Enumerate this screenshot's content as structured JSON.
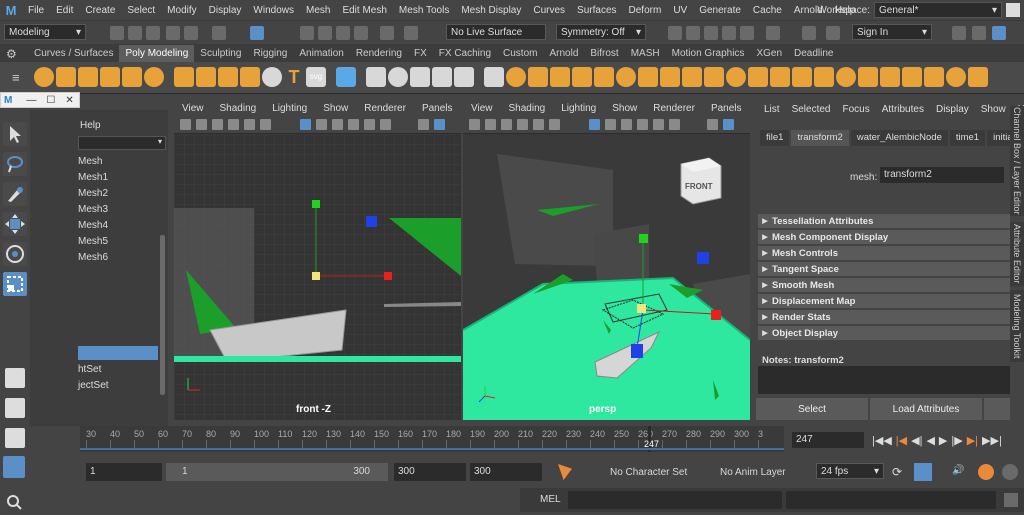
{
  "menubar": {
    "items": [
      "File",
      "Edit",
      "Create",
      "Select",
      "Modify",
      "Display",
      "Windows",
      "Mesh",
      "Edit Mesh",
      "Mesh Tools",
      "Mesh Display",
      "Curves",
      "Surfaces",
      "Deform",
      "UV",
      "Generate",
      "Cache",
      "Arnold",
      "Help"
    ],
    "workspace_label": "Workspace:",
    "workspace_value": "General*"
  },
  "statusline": {
    "mode": "Modeling",
    "live_surface": "No Live Surface",
    "symmetry": "Symmetry: Off",
    "sign_in": "Sign In"
  },
  "shelf_tabs": [
    "Curves / Surfaces",
    "Poly Modeling",
    "Sculpting",
    "Rigging",
    "Animation",
    "Rendering",
    "FX",
    "FX Caching",
    "Custom",
    "Arnold",
    "Bifrost",
    "MASH",
    "Motion Graphics",
    "XGen",
    "Deadline"
  ],
  "shelf_active_tab": "Poly Modeling",
  "outliner": {
    "help": "Help",
    "items": [
      "Mesh",
      "Mesh1",
      "Mesh2",
      "Mesh3",
      "Mesh4",
      "Mesh5",
      "Mesh6"
    ],
    "sets": [
      "htSet",
      "jectSet"
    ]
  },
  "viewport_left": {
    "menu": [
      "View",
      "Shading",
      "Lighting",
      "Show",
      "Renderer",
      "Panels"
    ],
    "label": "front -Z"
  },
  "viewport_right": {
    "menu": [
      "View",
      "Shading",
      "Lighting",
      "Show",
      "Renderer",
      "Panels"
    ],
    "label": "persp",
    "cube_label": "FRONT"
  },
  "channel_box": {
    "menu": [
      "List",
      "Selected",
      "Focus",
      "Attributes",
      "Display",
      "Show",
      "Help"
    ],
    "tabs": [
      "file1",
      "transform2",
      "water_AlembicNode",
      "time1",
      "initialS"
    ],
    "active_tab": "transform2",
    "mesh_label": "mesh:",
    "mesh_value": "transform2",
    "sections": [
      "Tessellation Attributes",
      "Mesh Component Display",
      "Mesh Controls",
      "Tangent Space",
      "Smooth Mesh",
      "Displacement Map",
      "Render Stats",
      "Object Display"
    ],
    "notes_label": "Notes:  transform2",
    "select_btn": "Select",
    "load_btn": "Load Attributes",
    "side_tabs": [
      "Channel Box / Layer Editor",
      "Attribute Editor",
      "Modeling Toolkit"
    ]
  },
  "timeline": {
    "ticks": [
      "30",
      "40",
      "50",
      "60",
      "70",
      "80",
      "90",
      "100",
      "110",
      "120",
      "130",
      "140",
      "150",
      "160",
      "170",
      "180",
      "190",
      "200",
      "210",
      "220",
      "230",
      "240",
      "250",
      "260",
      "270",
      "280",
      "290",
      "300",
      "3"
    ],
    "current_frame_label": "247",
    "current_frame_field": "247"
  },
  "range": {
    "start": "1",
    "slider_start": "1",
    "slider_end": "300",
    "end": "300",
    "end2": "300",
    "character_set": "No Character Set",
    "anim_layer": "No Anim Layer",
    "fps": "24 fps"
  },
  "cmd": {
    "mel": "MEL"
  },
  "colors": {
    "accent": "#5b8fc7",
    "icon_orange": "#e8a23a",
    "water": "#2ee8a0",
    "green": "#2aa62a"
  }
}
